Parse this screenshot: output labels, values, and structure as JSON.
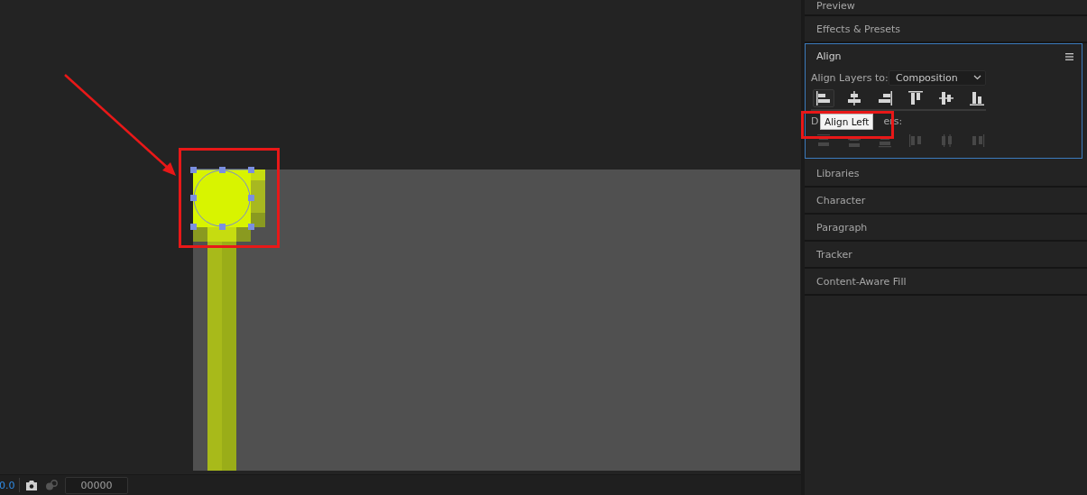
{
  "viewer": {
    "zoom": "0.0",
    "timecode": "00000"
  },
  "panels_above": [
    {
      "title": "Preview"
    },
    {
      "title": "Effects & Presets"
    }
  ],
  "align": {
    "title": "Align",
    "focused": true,
    "align_to_label": "Align Layers to:",
    "align_to_value": "Composition",
    "align_buttons": [
      {
        "kind": "left",
        "hovered": true
      },
      {
        "kind": "hcenter",
        "hovered": false
      },
      {
        "kind": "right",
        "hovered": false
      },
      {
        "kind": "top",
        "hovered": false
      },
      {
        "kind": "vcenter",
        "hovered": false
      },
      {
        "kind": "bottom",
        "hovered": false
      }
    ],
    "distribute_label_parts": [
      "D",
      "ers:"
    ],
    "distribute_buttons": [
      {
        "kind": "top",
        "disabled": true
      },
      {
        "kind": "vcenter",
        "disabled": true
      },
      {
        "kind": "bottom",
        "disabled": true
      },
      {
        "kind": "left",
        "disabled": true
      },
      {
        "kind": "hcenter",
        "disabled": true
      },
      {
        "kind": "right",
        "disabled": true
      }
    ],
    "tooltip": "Align Left"
  },
  "panels_below": [
    {
      "title": "Libraries"
    },
    {
      "title": "Character"
    },
    {
      "title": "Paragraph"
    },
    {
      "title": "Tracker"
    },
    {
      "title": "Content-Aware Fill"
    }
  ]
}
